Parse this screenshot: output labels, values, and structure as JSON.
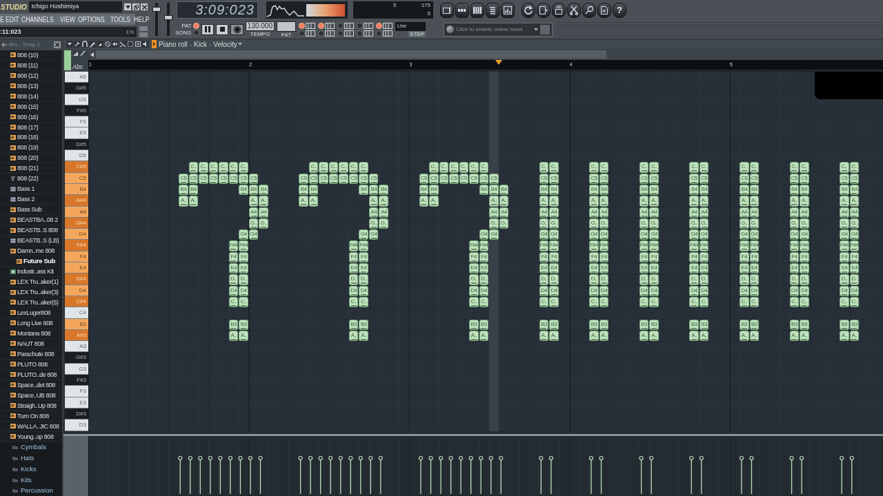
{
  "app": {
    "logo": "STUDIO",
    "title": "Ichigo Hoshimiya"
  },
  "menu": [
    "E",
    "EDIT",
    "CHANNELS",
    "VIEW",
    "OPTIONS",
    "TOOLS",
    "HELP"
  ],
  "hint_bar": {
    "text": ":11:023",
    "cpu": "1%"
  },
  "faders": [
    {
      "level": 0.85
    },
    {
      "level": 0.55
    }
  ],
  "transport": {
    "time": "3:09:023",
    "modes": [
      {
        "label": "PAT",
        "selected": true
      },
      {
        "label": "SONG",
        "selected": false
      }
    ],
    "tempo": "130.000",
    "tempo_label": "TEMPO",
    "pattern_label": "PAT"
  },
  "cpu_panel": {
    "values": [
      "5",
      "175",
      "5"
    ]
  },
  "help": "?",
  "options": [
    {
      "on": true
    },
    {
      "on": false
    },
    {
      "on": true
    },
    {
      "on": false
    },
    {
      "on": false
    },
    {
      "on": false
    },
    {
      "on": false
    },
    {
      "on": false
    },
    {
      "on": true
    },
    {
      "on": false
    }
  ],
  "snap": {
    "value": "Line",
    "caption": "STEP"
  },
  "news": {
    "placeholder": "Click to enable online news"
  },
  "browser": {
    "title": "Bro..",
    "snap": "Snap 1",
    "items": [
      {
        "label": "808 (10)",
        "kind": "sample",
        "selected": false
      },
      {
        "label": "808 (11)",
        "kind": "sample",
        "selected": false
      },
      {
        "label": "808 (12)",
        "kind": "sample",
        "selected": false
      },
      {
        "label": "808 (13)",
        "kind": "sample",
        "selected": false
      },
      {
        "label": "808 (14)",
        "kind": "sample",
        "selected": false
      },
      {
        "label": "808 (15)",
        "kind": "sample",
        "selected": false
      },
      {
        "label": "808 (16)",
        "kind": "sample",
        "selected": false
      },
      {
        "label": "808 (17)",
        "kind": "sample",
        "selected": false
      },
      {
        "label": "808 (18)",
        "kind": "sample",
        "selected": false
      },
      {
        "label": "808 (19)",
        "kind": "sample",
        "selected": false
      },
      {
        "label": "808 (20)",
        "kind": "sample",
        "selected": false
      },
      {
        "label": "808 (21)",
        "kind": "sample",
        "selected": false
      },
      {
        "label": "808 (22)",
        "kind": "script",
        "selected": false
      },
      {
        "label": "Bass 1",
        "kind": "preset",
        "selected": false
      },
      {
        "label": "Bass 2",
        "kind": "preset",
        "selected": false
      },
      {
        "label": "Bass Sub",
        "kind": "sample",
        "selected": false
      },
      {
        "label": "BEASTBA..08 2",
        "kind": "sample",
        "selected": false
      },
      {
        "label": "BEASTB..S  808",
        "kind": "sample",
        "selected": false
      },
      {
        "label": "BEASTB..S (LB)",
        "kind": "preset",
        "selected": false
      },
      {
        "label": "Damn..me 808",
        "kind": "sample",
        "selected": false
      },
      {
        "label": "Future Sub",
        "kind": "sample",
        "selected": true
      },
      {
        "label": "Industr..ass Kit",
        "kind": "kit",
        "selected": false
      },
      {
        "label": "LEX Tru..aker(1)",
        "kind": "sample",
        "selected": false
      },
      {
        "label": "LEX Tru..aker(3)",
        "kind": "sample",
        "selected": false
      },
      {
        "label": "LEX Tru..aker(5)",
        "kind": "sample",
        "selected": false
      },
      {
        "label": "LexLuger808",
        "kind": "sample",
        "selected": false
      },
      {
        "label": "Long Live 808",
        "kind": "sample",
        "selected": false
      },
      {
        "label": "Montana 808",
        "kind": "sample",
        "selected": false
      },
      {
        "label": "NAUT 808",
        "kind": "sample",
        "selected": false
      },
      {
        "label": "Parachute 808",
        "kind": "sample",
        "selected": false
      },
      {
        "label": "PLUTO 808",
        "kind": "sample",
        "selected": false
      },
      {
        "label": "PLUTO..de 808",
        "kind": "sample",
        "selected": false
      },
      {
        "label": "Space..det 808",
        "kind": "sample",
        "selected": false
      },
      {
        "label": "Space..UB 808",
        "kind": "sample",
        "selected": false
      },
      {
        "label": "Straigh..Up 808",
        "kind": "sample",
        "selected": false
      },
      {
        "label": "Turn On 808",
        "kind": "sample",
        "selected": false
      },
      {
        "label": "WALLA..JIC 808",
        "kind": "sample",
        "selected": false
      },
      {
        "label": "Young..op 808",
        "kind": "sample",
        "selected": false
      }
    ],
    "folders": [
      "Cymbals",
      "Hats",
      "Kicks",
      "Kits",
      "Percussion"
    ]
  },
  "piano_roll": {
    "title_parts": [
      {
        "text": "Piano roll",
        "kind": "title"
      },
      {
        "text": "-",
        "kind": "separator"
      },
      {
        "text": "Kick",
        "kind": "selector"
      },
      {
        "text": "-",
        "kind": "separator"
      },
      {
        "text": "Velocity",
        "kind": "selector"
      }
    ],
    "ruler_label": "Abc",
    "bars": [
      "1",
      "2",
      "3",
      "4",
      "5"
    ],
    "keys": [
      {
        "label": "A5",
        "kind": "white",
        "highlighted": false
      },
      {
        "label": "G#5",
        "kind": "black",
        "highlighted": false
      },
      {
        "label": "G5",
        "kind": "white",
        "highlighted": false
      },
      {
        "label": "F#5",
        "kind": "black",
        "highlighted": false
      },
      {
        "label": "F5",
        "kind": "white",
        "highlighted": false
      },
      {
        "label": "E5",
        "kind": "white",
        "highlighted": false
      },
      {
        "label": "D#5",
        "kind": "black",
        "highlighted": false
      },
      {
        "label": "D5",
        "kind": "white",
        "highlighted": false
      },
      {
        "label": "C#5",
        "kind": "black",
        "highlighted": true,
        "cells": [
          null,
          null,
          null,
          null,
          null,
          null,
          null,
          null,
          null,
          null,
          "C..",
          "C..",
          "C..",
          "C..",
          "C..",
          "C..",
          null,
          null,
          null,
          null,
          null,
          null,
          "C..",
          "C..",
          "C..",
          "C..",
          "C..",
          "C..",
          null,
          null,
          null,
          null,
          null,
          null,
          "C..",
          "C..",
          "C..",
          "C..",
          "C..",
          "C..",
          null,
          null,
          null,
          null,
          null,
          "C..",
          "C..",
          null,
          null,
          null,
          "C..",
          "C..",
          null,
          null,
          null,
          "C..",
          "C..",
          null,
          null,
          null,
          "C..",
          "C..",
          null,
          null,
          null,
          "C..",
          "C..",
          null,
          null,
          null,
          "C..",
          "C..",
          null,
          null,
          null,
          "C..",
          "C.."
        ]
      },
      {
        "label": "C5",
        "kind": "white",
        "highlighted": true,
        "cells": [
          null,
          null,
          null,
          null,
          null,
          null,
          null,
          null,
          null,
          "C5",
          "C5",
          "C5",
          "C5",
          "C5",
          "C5",
          "C5",
          "C5",
          null,
          null,
          null,
          null,
          "C5",
          "C5",
          "C5",
          "C5",
          "C5",
          "C5",
          "C5",
          "C5",
          null,
          null,
          null,
          null,
          "C5",
          "C5",
          "C5",
          "C5",
          "C5",
          "C5",
          "C5",
          "C5",
          null,
          null,
          null,
          null,
          "C5",
          "C5",
          null,
          null,
          null,
          "C5",
          "C5",
          null,
          null,
          null,
          "C5",
          "C5",
          null,
          null,
          null,
          "C5",
          "C5",
          null,
          null,
          null,
          "C5",
          "C5",
          null,
          null,
          null,
          "C5",
          "C5",
          null,
          null,
          null,
          "C5",
          "C5"
        ]
      },
      {
        "label": "B4",
        "kind": "white",
        "highlighted": true,
        "cells": [
          null,
          null,
          null,
          null,
          null,
          null,
          null,
          null,
          null,
          "B4",
          "B4",
          null,
          null,
          null,
          null,
          "B4",
          "B4",
          "B4",
          null,
          null,
          null,
          "B4",
          "B4",
          null,
          null,
          null,
          null,
          "B4",
          "B4",
          "B4",
          null,
          null,
          null,
          "B4",
          "B4",
          null,
          null,
          null,
          null,
          "B4",
          "B4",
          "B4",
          null,
          null,
          null,
          "B4",
          "B4",
          null,
          null,
          null,
          "B4",
          "B4",
          null,
          null,
          null,
          "B4",
          "B4",
          null,
          null,
          null,
          "B4",
          "B4",
          null,
          null,
          null,
          "B4",
          "B4",
          null,
          null,
          null,
          "B4",
          "B4",
          null,
          null,
          null,
          "B4",
          "B4"
        ]
      },
      {
        "label": "A#4",
        "kind": "black",
        "highlighted": true,
        "cells": [
          null,
          null,
          null,
          null,
          null,
          null,
          null,
          null,
          null,
          "A..",
          "A..",
          null,
          null,
          null,
          null,
          null,
          "A..",
          "A..",
          null,
          null,
          null,
          "A..",
          "A..",
          null,
          null,
          null,
          null,
          null,
          "A..",
          "A..",
          null,
          null,
          null,
          "A..",
          "A..",
          null,
          null,
          null,
          null,
          null,
          "A..",
          "A..",
          null,
          null,
          null,
          "A..",
          "A..",
          null,
          null,
          null,
          "A..",
          "A..",
          null,
          null,
          null,
          "A..",
          "A..",
          null,
          null,
          null,
          "A..",
          "A..",
          null,
          null,
          null,
          "A..",
          "A..",
          null,
          null,
          null,
          "A..",
          "A..",
          null,
          null,
          null,
          "A..",
          "A.."
        ]
      },
      {
        "label": "A4",
        "kind": "white",
        "highlighted": true,
        "cells": [
          null,
          null,
          null,
          null,
          null,
          null,
          null,
          null,
          null,
          null,
          null,
          null,
          null,
          null,
          null,
          null,
          "A4",
          "A4",
          null,
          null,
          null,
          null,
          null,
          null,
          null,
          null,
          null,
          null,
          "A4",
          "A4",
          null,
          null,
          null,
          null,
          null,
          null,
          null,
          null,
          null,
          null,
          "A4",
          "A4",
          null,
          null,
          null,
          "A4",
          "A4",
          null,
          null,
          null,
          "A4",
          "A4",
          null,
          null,
          null,
          "A4",
          "A4",
          null,
          null,
          null,
          "A4",
          "A4",
          null,
          null,
          null,
          "A4",
          "A4",
          null,
          null,
          null,
          "A4",
          "A4",
          null,
          null,
          null,
          "A4",
          "A4"
        ]
      },
      {
        "label": "G#4",
        "kind": "black",
        "highlighted": true,
        "cells": [
          null,
          null,
          null,
          null,
          null,
          null,
          null,
          null,
          null,
          null,
          null,
          null,
          null,
          null,
          null,
          null,
          "G..",
          "G..",
          null,
          null,
          null,
          null,
          null,
          null,
          null,
          null,
          null,
          null,
          "G..",
          "G..",
          null,
          null,
          null,
          null,
          null,
          null,
          null,
          null,
          null,
          null,
          "G..",
          "G..",
          null,
          null,
          null,
          "G..",
          "G..",
          null,
          null,
          null,
          "G..",
          "G..",
          null,
          null,
          null,
          "G..",
          "G..",
          null,
          null,
          null,
          "G..",
          "G..",
          null,
          null,
          null,
          "G..",
          "G..",
          null,
          null,
          null,
          "G..",
          "G..",
          null,
          null,
          null,
          "G..",
          "G.."
        ]
      },
      {
        "label": "G4",
        "kind": "white",
        "highlighted": true,
        "cells": [
          null,
          null,
          null,
          null,
          null,
          null,
          null,
          null,
          null,
          null,
          null,
          null,
          null,
          null,
          null,
          "G4",
          "G4",
          null,
          null,
          null,
          null,
          null,
          null,
          null,
          null,
          null,
          null,
          "G4",
          "G4",
          null,
          null,
          null,
          null,
          null,
          null,
          null,
          null,
          null,
          null,
          "G4",
          "G4",
          null,
          null,
          null,
          null,
          "G4",
          "G4",
          null,
          null,
          null,
          "G4",
          "G4",
          null,
          null,
          null,
          "G4",
          "G4",
          null,
          null,
          null,
          "G4",
          "G4",
          null,
          null,
          null,
          "G4",
          "G4",
          null,
          null,
          null,
          "G4",
          "G4",
          null,
          null,
          null,
          "G4",
          "G4"
        ]
      },
      {
        "label": "F#4",
        "kind": "black",
        "highlighted": true,
        "cells": [
          null,
          null,
          null,
          null,
          null,
          null,
          null,
          null,
          null,
          null,
          null,
          null,
          null,
          null,
          "F#4",
          "F#4",
          null,
          null,
          null,
          null,
          null,
          null,
          null,
          null,
          null,
          null,
          "F#4",
          "F#4",
          null,
          null,
          null,
          null,
          null,
          null,
          null,
          null,
          null,
          null,
          "F#4",
          "F#4",
          null,
          null,
          null,
          null,
          null,
          "F#4",
          "F#4",
          null,
          null,
          null,
          "F#4",
          "F#4",
          null,
          null,
          null,
          "F#4",
          "F#4",
          null,
          null,
          null,
          "F#4",
          "F#4",
          null,
          null,
          null,
          "F#4",
          "F#4",
          null,
          null,
          null,
          "F#4",
          "F#4",
          null,
          null,
          null,
          "F#4",
          "F#4"
        ]
      },
      {
        "label": "F4",
        "kind": "white",
        "highlighted": true,
        "cells": [
          null,
          null,
          null,
          null,
          null,
          null,
          null,
          null,
          null,
          null,
          null,
          null,
          null,
          null,
          "F4",
          "F4",
          null,
          null,
          null,
          null,
          null,
          null,
          null,
          null,
          null,
          null,
          "F4",
          "F4",
          null,
          null,
          null,
          null,
          null,
          null,
          null,
          null,
          null,
          null,
          "F4",
          "F4",
          null,
          null,
          null,
          null,
          null,
          "F4",
          "F4",
          null,
          null,
          null,
          "F4",
          "F4",
          null,
          null,
          null,
          "F4",
          "F4",
          null,
          null,
          null,
          "F4",
          "F4",
          null,
          null,
          null,
          "F4",
          "F4",
          null,
          null,
          null,
          "F4",
          "F4",
          null,
          null,
          null,
          "F4",
          "F4"
        ]
      },
      {
        "label": "E4",
        "kind": "white",
        "highlighted": true,
        "cells": [
          null,
          null,
          null,
          null,
          null,
          null,
          null,
          null,
          null,
          null,
          null,
          null,
          null,
          null,
          "E4",
          "E4",
          null,
          null,
          null,
          null,
          null,
          null,
          null,
          null,
          null,
          null,
          "E4",
          "E4",
          null,
          null,
          null,
          null,
          null,
          null,
          null,
          null,
          null,
          null,
          "E4",
          "E4",
          null,
          null,
          null,
          null,
          null,
          "E4",
          "E4",
          null,
          null,
          null,
          "E4",
          "E4",
          null,
          null,
          null,
          "E4",
          "E4",
          null,
          null,
          null,
          "E4",
          "E4",
          null,
          null,
          null,
          "E4",
          "E4",
          null,
          null,
          null,
          "E4",
          "E4",
          null,
          null,
          null,
          "E4",
          "E4"
        ]
      },
      {
        "label": "D#4",
        "kind": "black",
        "highlighted": true,
        "cells": [
          null,
          null,
          null,
          null,
          null,
          null,
          null,
          null,
          null,
          null,
          null,
          null,
          null,
          null,
          "D..",
          "D..",
          null,
          null,
          null,
          null,
          null,
          null,
          null,
          null,
          null,
          null,
          "D..",
          "D..",
          null,
          null,
          null,
          null,
          null,
          null,
          null,
          null,
          null,
          null,
          "D..",
          "D..",
          null,
          null,
          null,
          null,
          null,
          "D..",
          "D..",
          null,
          null,
          null,
          "D..",
          "D..",
          null,
          null,
          null,
          "D..",
          "D..",
          null,
          null,
          null,
          "D..",
          "D..",
          null,
          null,
          null,
          "D..",
          "D..",
          null,
          null,
          null,
          "D..",
          "D..",
          null,
          null,
          null,
          "D..",
          "D.."
        ]
      },
      {
        "label": "D4",
        "kind": "white",
        "highlighted": true,
        "cells": [
          null,
          null,
          null,
          null,
          null,
          null,
          null,
          null,
          null,
          null,
          null,
          null,
          null,
          null,
          "D4",
          "D4",
          null,
          null,
          null,
          null,
          null,
          null,
          null,
          null,
          null,
          null,
          "D4",
          "D4",
          null,
          null,
          null,
          null,
          null,
          null,
          null,
          null,
          null,
          null,
          "D4",
          "D4",
          null,
          null,
          null,
          null,
          null,
          "D4",
          "D4",
          null,
          null,
          null,
          "D4",
          "D4",
          null,
          null,
          null,
          "D4",
          "D4",
          null,
          null,
          null,
          "D4",
          "D4",
          null,
          null,
          null,
          "D4",
          "D4",
          null,
          null,
          null,
          "D4",
          "D4",
          null,
          null,
          null,
          "D4",
          "D4"
        ]
      },
      {
        "label": "C#4",
        "kind": "black",
        "highlighted": true,
        "cells": [
          null,
          null,
          null,
          null,
          null,
          null,
          null,
          null,
          null,
          null,
          null,
          null,
          null,
          null,
          "C..",
          "C..",
          null,
          null,
          null,
          null,
          null,
          null,
          null,
          null,
          null,
          null,
          "C..",
          "C..",
          null,
          null,
          null,
          null,
          null,
          null,
          null,
          null,
          null,
          null,
          "C..",
          "C..",
          null,
          null,
          null,
          null,
          null,
          "C..",
          "C..",
          null,
          null,
          null,
          "C..",
          "C..",
          null,
          null,
          null,
          "C..",
          "C..",
          null,
          null,
          null,
          "C..",
          "C..",
          null,
          null,
          null,
          "C..",
          "C..",
          null,
          null,
          null,
          "C..",
          "C..",
          null,
          null,
          null,
          "C..",
          "C.."
        ]
      },
      {
        "label": "C4",
        "kind": "white",
        "highlighted": false
      },
      {
        "label": "B3",
        "kind": "white",
        "highlighted": true,
        "cells": [
          null,
          null,
          null,
          null,
          null,
          null,
          null,
          null,
          null,
          null,
          null,
          null,
          null,
          null,
          "B3",
          "B3",
          null,
          null,
          null,
          null,
          null,
          null,
          null,
          null,
          null,
          null,
          "B3",
          "B3",
          null,
          null,
          null,
          null,
          null,
          null,
          null,
          null,
          null,
          null,
          "B3",
          "B3",
          null,
          null,
          null,
          null,
          null,
          "B3",
          "B3",
          null,
          null,
          null,
          "B3",
          "B3",
          null,
          null,
          null,
          "B3",
          "B3",
          null,
          null,
          null,
          "B3",
          "B3",
          null,
          null,
          null,
          "B3",
          "B3",
          null,
          null,
          null,
          "B3",
          "B3",
          null,
          null,
          null,
          "B3",
          "B3"
        ]
      },
      {
        "label": "A#3",
        "kind": "black",
        "highlighted": true,
        "cells": [
          null,
          null,
          null,
          null,
          null,
          null,
          null,
          null,
          null,
          null,
          null,
          null,
          null,
          null,
          "A..",
          "A..",
          null,
          null,
          null,
          null,
          null,
          null,
          null,
          null,
          null,
          null,
          "A..",
          "A..",
          null,
          null,
          null,
          null,
          null,
          null,
          null,
          null,
          null,
          null,
          "A..",
          "A..",
          null,
          null,
          null,
          null,
          null,
          "A..",
          "A..",
          null,
          null,
          null,
          "A..",
          "A..",
          null,
          null,
          null,
          "A..",
          "A..",
          null,
          null,
          null,
          "A..",
          "A..",
          null,
          null,
          null,
          "A..",
          "A..",
          null,
          null,
          null,
          "A..",
          "A..",
          null,
          null,
          null,
          "A..",
          "A.."
        ]
      },
      {
        "label": "A3",
        "kind": "white",
        "highlighted": false
      },
      {
        "label": "G#3",
        "kind": "black",
        "highlighted": false
      },
      {
        "label": "G3",
        "kind": "white",
        "highlighted": false
      },
      {
        "label": "F#3",
        "kind": "black",
        "highlighted": false
      },
      {
        "label": "F3",
        "kind": "white",
        "highlighted": false
      },
      {
        "label": "E3",
        "kind": "white",
        "highlighted": false
      },
      {
        "label": "D#3",
        "kind": "black",
        "highlighted": false
      },
      {
        "label": "D3",
        "kind": "white",
        "highlighted": false
      }
    ]
  }
}
